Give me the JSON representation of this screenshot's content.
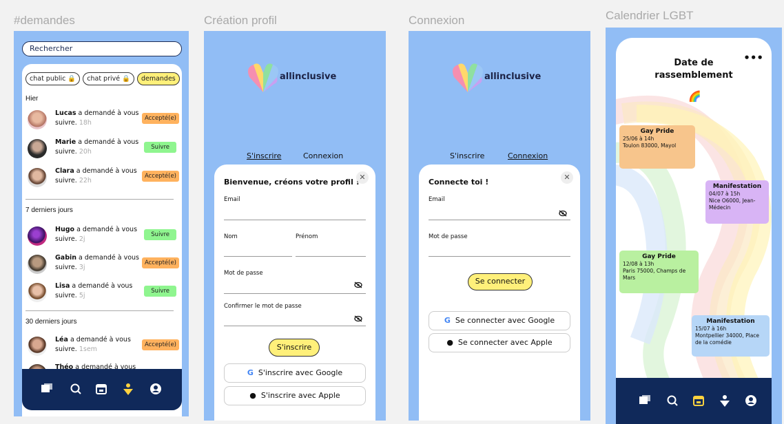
{
  "frames": {
    "demandes": "#demandes",
    "creation": "Création profil",
    "connexion": "Connexion",
    "calendrier": "Calendrier LGBT"
  },
  "demandes": {
    "search_placeholder": "Rechercher",
    "pills": [
      "chat public 🔒",
      "chat privé 🔒",
      "demandes"
    ],
    "sections": [
      "Hier",
      "7 derniers  jours",
      "30 derniers  jours"
    ],
    "rows": [
      {
        "name": "Lucas",
        "text": " a demandé à vous suivre. ",
        "ago": "18h",
        "action": "Accepté(e)",
        "type": "accepted"
      },
      {
        "name": "Marie",
        "text": " a demandé à vous suivre. ",
        "ago": "20h",
        "action": "Suivre",
        "type": "follow"
      },
      {
        "name": "Clara",
        "text": " a demandé à vous suivre. ",
        "ago": "22h",
        "action": "Accepté(e)",
        "type": "accepted"
      },
      {
        "name": "Hugo",
        "text": " a demandé à vous suivre. ",
        "ago": "2j",
        "action": "Suivre",
        "type": "follow"
      },
      {
        "name": "Gabin",
        "text": " a demandé à vous suivre. ",
        "ago": "3j",
        "action": "Accepté(e)",
        "type": "accepted"
      },
      {
        "name": "Lisa",
        "text": " a demandé à vous suivre. ",
        "ago": "5j",
        "action": "Suivre",
        "type": "follow"
      },
      {
        "name": "Léa",
        "text": " a demandé à vous suivre. ",
        "ago": "1sem",
        "action": "Accepté(e)",
        "type": "accepted"
      },
      {
        "name": "Théo",
        "text": " a demandé à vous",
        "ago": "",
        "action": "",
        "type": "partial"
      }
    ]
  },
  "brand": "allinclusive",
  "creation": {
    "tab_signup": "S'inscrire",
    "tab_login": "Connexion",
    "title": "Bienvenue,  créons votre profil !",
    "email": "Email",
    "nom": "Nom",
    "prenom": "Prénom",
    "password": "Mot de passe",
    "confirm": "Confirmer le mot de passe",
    "submit": "S'inscrire",
    "google": "S'inscrire avec Google",
    "apple": "S'inscrire avec Apple"
  },
  "connexion": {
    "tab_signup": "S'inscrire",
    "tab_login": "Connexion",
    "title": "Connecte toi !",
    "email": "Email",
    "password": "Mot de passe",
    "submit": "Se connecter",
    "google": "Se connecter avec Google",
    "apple": "Se connecter avec Apple"
  },
  "calendrier": {
    "title_line1": "Date de",
    "title_line2": "rassemblement",
    "events": [
      {
        "title": "Gay Pride",
        "date": "25/06  à 14h",
        "place": "Toulon 83000, Mayol",
        "color": "#f7c58c"
      },
      {
        "title": "Manifestation",
        "date": "04/07  à 15h",
        "place": "Nice O6000, Jean-Médecin",
        "color": "#d8b4f5"
      },
      {
        "title": "Gay Pride",
        "date": "12/08 à 13h",
        "place": "Paris 75000, Champs de Mars",
        "color": "#b9f0a0"
      },
      {
        "title": "Manifestation",
        "date": "15/07 à 16h",
        "place": "Montpellier 34000, Place de la comédie",
        "color": "#b6d6f7"
      }
    ]
  },
  "colors": {
    "accent_yellow": "#fff07a",
    "navy": "#10295a",
    "frame_blue": "#91bdf5",
    "accepted": "#ffb25e",
    "follow": "#8ff58f"
  }
}
